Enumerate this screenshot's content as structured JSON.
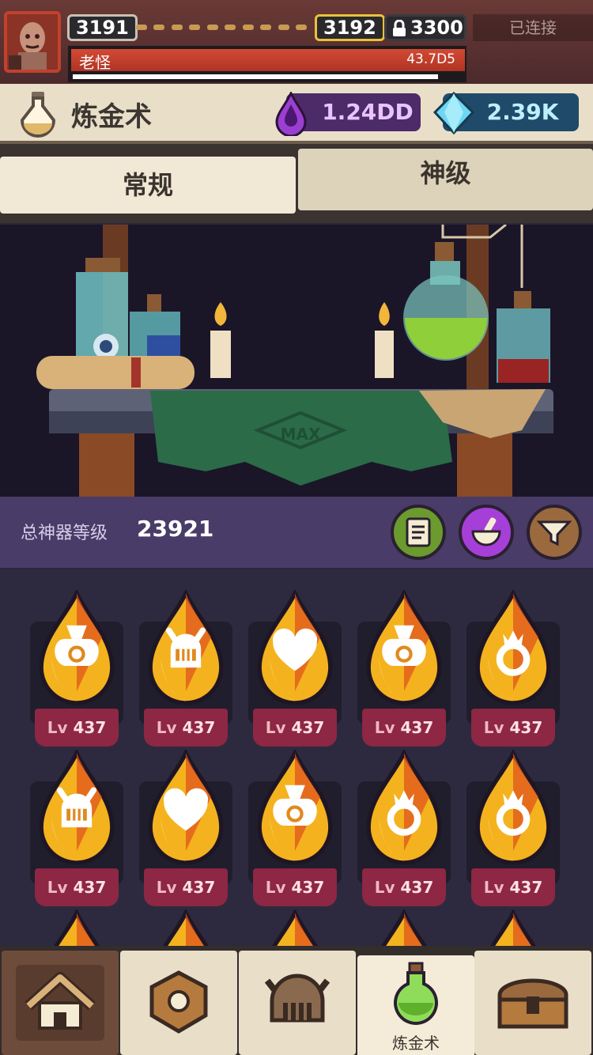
{
  "topbar": {
    "stage_current": "3191",
    "stage_next": "3192",
    "stage_locked": "3300",
    "connection_status": "已连接",
    "boss_name": "老怪",
    "boss_hp": "43.7D5"
  },
  "header": {
    "title": "炼金术",
    "currency_purple": "1.24DD",
    "currency_blue": "2.39K"
  },
  "tabs": [
    {
      "label": "常规"
    },
    {
      "label": "神级"
    }
  ],
  "scene": {
    "cloth_label": "MAX"
  },
  "artifact_level": {
    "label": "总神器等级",
    "value": "23921"
  },
  "artifacts": [
    {
      "icon": "money-bag-icon",
      "lv_prefix": "Lv",
      "lv": "437"
    },
    {
      "icon": "helmet-icon",
      "lv_prefix": "Lv",
      "lv": "437"
    },
    {
      "icon": "heart-icon",
      "lv_prefix": "Lv",
      "lv": "437"
    },
    {
      "icon": "money-bag-icon",
      "lv_prefix": "Lv",
      "lv": "437"
    },
    {
      "icon": "crown-ring-icon",
      "lv_prefix": "Lv",
      "lv": "437"
    },
    {
      "icon": "helmet-icon",
      "lv_prefix": "Lv",
      "lv": "437"
    },
    {
      "icon": "heart-icon",
      "lv_prefix": "Lv",
      "lv": "437"
    },
    {
      "icon": "money-bag-icon",
      "lv_prefix": "Lv",
      "lv": "437"
    },
    {
      "icon": "crown-ring-icon",
      "lv_prefix": "Lv",
      "lv": "437"
    },
    {
      "icon": "crown-ring-icon",
      "lv_prefix": "Lv",
      "lv": "437"
    }
  ],
  "bottom_nav": [
    {
      "icon": "home-icon",
      "label": ""
    },
    {
      "icon": "hexnut-icon",
      "label": ""
    },
    {
      "icon": "helmet-icon",
      "label": ""
    },
    {
      "icon": "potion-icon",
      "label": "炼金术"
    },
    {
      "icon": "chest-icon",
      "label": ""
    }
  ],
  "colors": {
    "accent_red": "#c2412d",
    "gold": "#e8c23a",
    "purple": "#4d2a68",
    "blue": "#1f4a6a",
    "badge": "#8d2743"
  }
}
